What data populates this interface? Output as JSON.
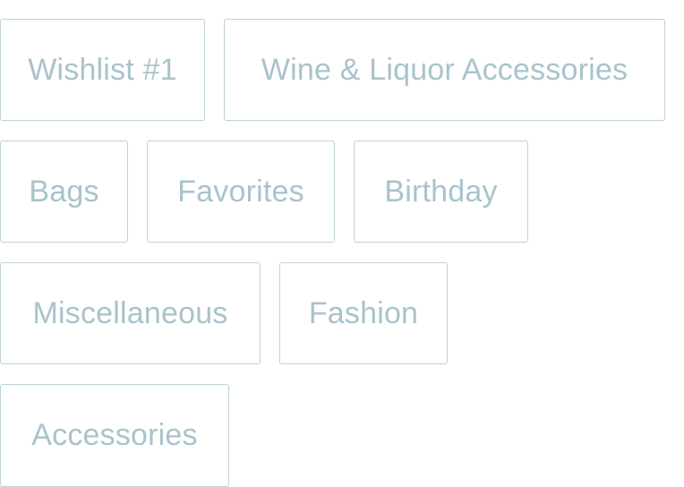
{
  "collections": {
    "items": [
      {
        "label": "Wishlist #1"
      },
      {
        "label": "Wine & Liquor Accessories"
      },
      {
        "label": "Bags"
      },
      {
        "label": "Favorites"
      },
      {
        "label": "Birthday"
      },
      {
        "label": "Miscellaneous"
      },
      {
        "label": "Fashion"
      },
      {
        "label": "Accessories"
      }
    ]
  },
  "colors": {
    "border": "#bdd2d9",
    "text": "#a9c3cc",
    "background": "#ffffff"
  }
}
